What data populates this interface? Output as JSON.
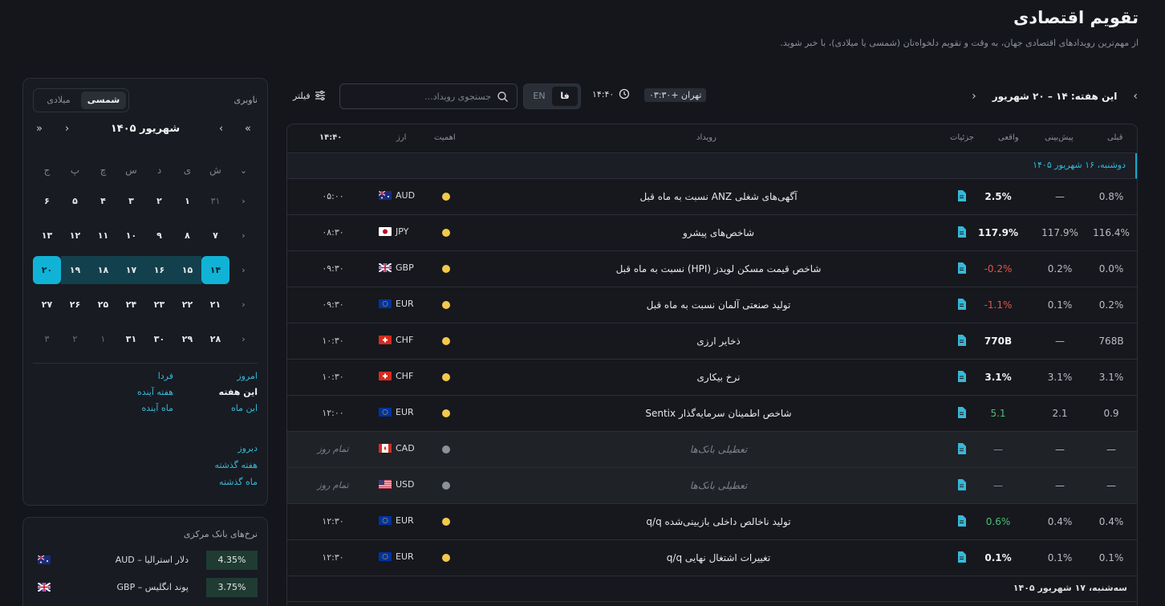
{
  "header": {
    "title": "تقویم اقتصادی",
    "subtitle": "از مهم‌ترین رویدادهای اقتصادی جهان، به وقت و تقویم دلخواه‌تان (شمسی یا میلادی)، با خبر شوید."
  },
  "sidebar": {
    "nav_title": "ناوبری",
    "calendar_types": [
      "شمسی",
      "میلادی"
    ],
    "month_label": "شهریور ۱۴۰۵",
    "weekdays": [
      "ش",
      "ی",
      "د",
      "س",
      "چ",
      "پ",
      "ج"
    ],
    "weeks": [
      [
        "۳۱",
        "۱",
        "۲",
        "۳",
        "۴",
        "۵",
        "۶"
      ],
      [
        "۷",
        "۸",
        "۹",
        "۱۰",
        "۱۱",
        "۱۲",
        "۱۳"
      ],
      [
        "۱۴",
        "۱۵",
        "۱۶",
        "۱۷",
        "۱۸",
        "۱۹",
        "۲۰"
      ],
      [
        "۲۱",
        "۲۲",
        "۲۳",
        "۲۴",
        "۲۵",
        "۲۶",
        "۲۷"
      ],
      [
        "۲۸",
        "۲۹",
        "۳۰",
        "۳۱",
        "۱",
        "۲",
        "۳"
      ]
    ],
    "quick_links": [
      "امروز",
      "فردا",
      "این هفته",
      "هفته آینده",
      "این ماه",
      "ماه آینده"
    ],
    "past_links": [
      "دیروز",
      "هفته گذشته",
      "ماه گذشته"
    ],
    "rates_title": "نرخ‌های بانک مرکزی",
    "rates": [
      {
        "name": "دلار استرالیا – AUD",
        "value": "4.35%"
      },
      {
        "name": "پوند انگلیس – GBP",
        "value": "3.75%"
      }
    ]
  },
  "toolbar": {
    "week_label": "این هفته: ۱۴ – ۲۰ شهریور",
    "timezone": "تهران +۰۳:۳۰",
    "clock": "۱۴:۴۰",
    "lang_fa": "فا",
    "lang_en": "EN",
    "search_placeholder": "جستجوی رویداد...",
    "filter_label": "فیلتر"
  },
  "table": {
    "columns": {
      "time": "۱۴:۴۰",
      "currency": "ارز",
      "importance": "اهمیت",
      "event": "رویداد",
      "details": "جزئیات",
      "actual": "واقعی",
      "forecast": "پیش‌بینی",
      "previous": "قبلی"
    },
    "day1": "دوشنبه، ۱۶ شهریور ۱۴۰۵",
    "day2": "سه‌شنبه، ۱۷ شهریور ۱۴۰۵",
    "rows": [
      {
        "time": "۰۵:۰۰",
        "currency": "AUD",
        "event": "آگهی‌های شغلی ANZ نسبت به ماه قبل",
        "actual": "2.5%",
        "forecast": "—",
        "previous": "0.8%"
      },
      {
        "time": "۰۸:۳۰",
        "currency": "JPY",
        "event": "شاخص‌های پیشرو",
        "actual": "117.9%",
        "forecast": "117.9%",
        "previous": "116.4%"
      },
      {
        "time": "۰۹:۳۰",
        "currency": "GBP",
        "event": "شاخص قیمت مسکن لویدز (HPI) نسبت به ماه قبل",
        "actual": "-0.2%",
        "forecast": "0.2%",
        "previous": "0.0%"
      },
      {
        "time": "۰۹:۳۰",
        "currency": "EUR",
        "event": "تولید صنعتی آلمان نسبت به ماه قبل",
        "actual": "-1.1%",
        "forecast": "0.1%",
        "previous": "0.2%"
      },
      {
        "time": "۱۰:۳۰",
        "currency": "CHF",
        "event": "ذخایر ارزی",
        "actual": "770B",
        "forecast": "—",
        "previous": "768B"
      },
      {
        "time": "۱۰:۳۰",
        "currency": "CHF",
        "event": "نرخ بیکاری",
        "actual": "3.1%",
        "forecast": "3.1%",
        "previous": "3.1%"
      },
      {
        "time": "۱۲:۰۰",
        "currency": "EUR",
        "event": "شاخص اطمینان سرمایه‌گذار Sentix",
        "actual": "5.1",
        "forecast": "2.1",
        "previous": "0.9"
      },
      {
        "time": "تمام روز",
        "currency": "CAD",
        "event": "تعطیلی بانک‌ها",
        "actual": "—",
        "forecast": "—",
        "previous": "—"
      },
      {
        "time": "تمام روز",
        "currency": "USD",
        "event": "تعطیلی بانک‌ها",
        "actual": "—",
        "forecast": "—",
        "previous": "—"
      },
      {
        "time": "۱۲:۳۰",
        "currency": "EUR",
        "event": "تولید ناخالص داخلی بازبینی‌شده q/q",
        "actual": "0.6%",
        "forecast": "0.4%",
        "previous": "0.4%"
      },
      {
        "time": "۱۲:۳۰",
        "currency": "EUR",
        "event": "تغییرات اشتغال نهایی q/q",
        "actual": "0.1%",
        "forecast": "0.1%",
        "previous": "0.1%"
      }
    ]
  },
  "colors": {
    "accent": "#10b3d6",
    "positive": "#4cbf7a",
    "negative": "#e5534b",
    "importance": "#f2c94c"
  }
}
